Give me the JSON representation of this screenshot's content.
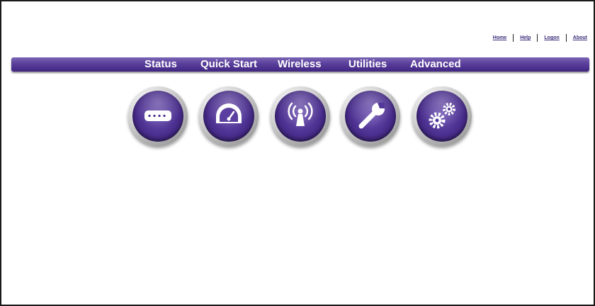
{
  "top_links": [
    "Home",
    "Help",
    "Logon",
    "About"
  ],
  "nav": {
    "items": [
      "Status",
      "Quick Start",
      "Wireless",
      "Utilities",
      "Advanced"
    ]
  },
  "icons": [
    {
      "name": "router-icon"
    },
    {
      "name": "speedometer-icon"
    },
    {
      "name": "wireless-antenna-icon"
    },
    {
      "name": "wrench-icon"
    },
    {
      "name": "gears-icon"
    }
  ],
  "colors": {
    "nav_bar": "#5a3f9b",
    "icon_purple": "#4a2e8e",
    "link": "#3a2a7a"
  }
}
